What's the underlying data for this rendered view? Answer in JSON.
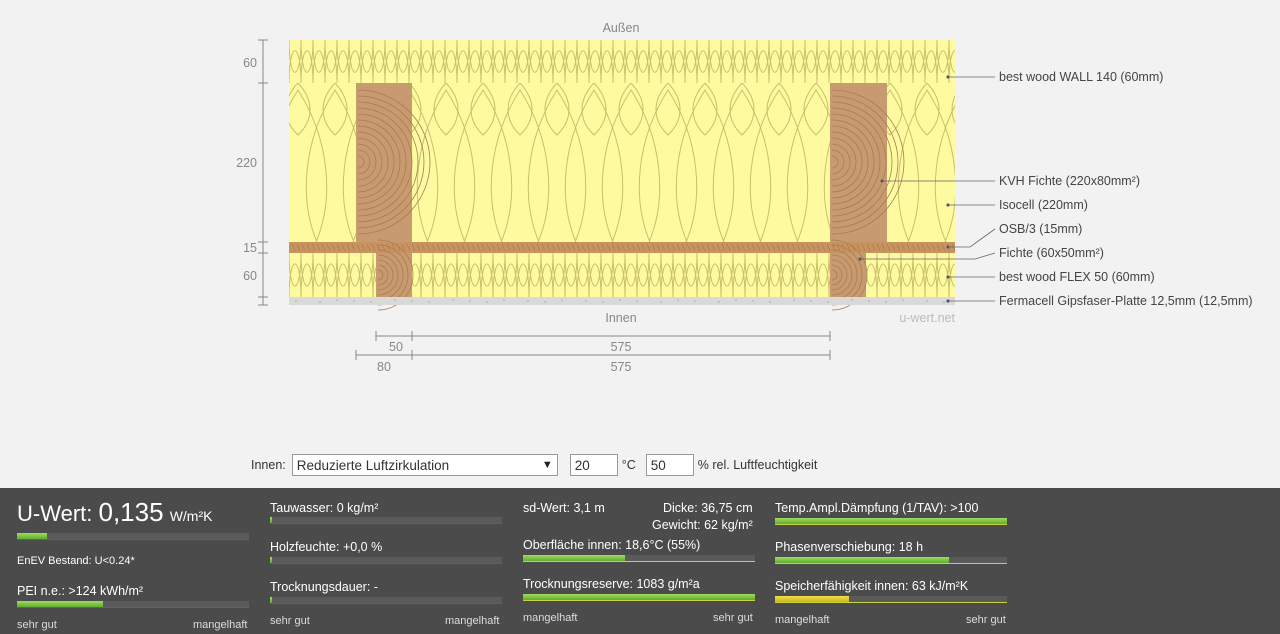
{
  "diagram": {
    "outside_label": "Außen",
    "inside_label": "Innen",
    "watermark": "u-wert.net",
    "layers": [
      {
        "id": "wall140",
        "label": "best wood WALL 140 (60mm)"
      },
      {
        "id": "kvh",
        "label": "KVH Fichte (220x80mm²)"
      },
      {
        "id": "isocell",
        "label": "Isocell (220mm)"
      },
      {
        "id": "osb",
        "label": "OSB/3 (15mm)"
      },
      {
        "id": "fichte",
        "label": "Fichte (60x50mm²)"
      },
      {
        "id": "flex50",
        "label": "best wood FLEX 50 (60mm)"
      },
      {
        "id": "fermacell",
        "label": "Fermacell Gipsfaser-Platte 12,5mm (12,5mm)"
      }
    ],
    "thickness_dims": [
      "60",
      "220",
      "15",
      "60"
    ],
    "width_dims": [
      {
        "small": "50",
        "large": "575"
      },
      {
        "small": "80",
        "large": "575"
      }
    ],
    "colors": {
      "insulation": "#fdfaa0",
      "insulation_line": "#c9c06a",
      "timber": "#c89a6f",
      "osb": "#c79360",
      "board": "#d9d9d9"
    }
  },
  "controls": {
    "inside_label": "Innen:",
    "climate": "Reduzierte Luftzirkulation",
    "temperature": "20",
    "temp_unit": "°C",
    "humidity": "50",
    "humidity_unit": "% rel. Luftfeuchtigkeit"
  },
  "results": {
    "uwert_label": "U-Wert:",
    "uwert_value": "0,135",
    "uwert_unit": "W/m²K",
    "enev": "EnEV Bestand: U<0.24*",
    "pei": "PEI n.e.: >124 kWh/m²",
    "tauwasser": "Tauwasser: 0 kg/m²",
    "holzfeuchte": "Holzfeuchte: +0,0 %",
    "trocknungsdauer": "Trocknungsdauer: -",
    "sd_wert": "sd-Wert: 3,1 m",
    "dicke": "Dicke: 36,75 cm",
    "gewicht": "Gewicht: 62 kg/m²",
    "oberflaeche": "Oberfläche innen: 18,6°C (55%)",
    "trocknungsreserve": "Trocknungsreserve: 1083 g/m²a",
    "temp_ampl": "Temp.Ampl.Dämpfung (1/TAV): >100",
    "phasen": "Phasenverschiebung: 18 h",
    "speicher": "Speicherfähigkeit innen: 63 kJ/m²K",
    "scale_good": "sehr gut",
    "scale_bad": "mangelhaft",
    "bars": {
      "uwert": 0.13,
      "pei": 0.37,
      "tauwasser": 0.01,
      "holzfeuchte": 0.01,
      "trocknungsdauer": 0.01,
      "oberflaeche": 0.44,
      "trocknungsreserve": 1.0,
      "temp_ampl": 1.0,
      "phasen": 0.75,
      "speicher": 0.32
    }
  }
}
